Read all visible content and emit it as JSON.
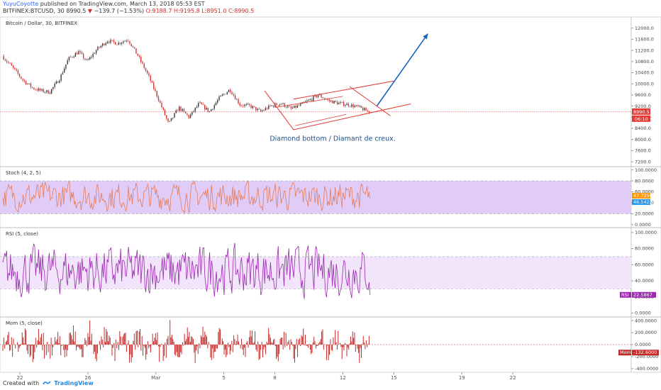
{
  "header": {
    "user": "YuyuCoyotte",
    "published": "published on TradingView.com, March 13, 2018 05:53 EST",
    "symbol": "BITFINEX:BTCUSD, 30",
    "last": "8990.5",
    "change": "−139.7 (−1.53%)",
    "ohlc": "O:9188.7 H:9195.8 L:8951.0 C:8990.5"
  },
  "footer": {
    "created": "Created with",
    "brand": "TradingView"
  },
  "colors": {
    "candle_up": "#333333",
    "candle_down": "#d32f2f",
    "pattern": "#e53935",
    "arrow": "#1565c0",
    "stoch_line": "#e57c5a",
    "stoch_band": "#e0ccf6",
    "rsi_line": "#9c27b0",
    "rsi_band": "#f1e4fb",
    "mom_line": "#c62828",
    "price_line": "#e53935"
  },
  "chart_data": [
    {
      "type": "candlestick",
      "title": "Bitcoin / Dollar, 30, BITFINEX",
      "y_ticks": [
        "12000.0",
        "11600.0",
        "11200.0",
        "10800.0",
        "10400.0",
        "10000.0",
        "9600.0",
        "9200.0",
        "8800.0",
        "8400.0",
        "8000.0",
        "7600.0",
        "7200.0"
      ],
      "ylim": [
        7050,
        12400
      ],
      "last_price": "8990.5",
      "countdown": "06:10",
      "close_path": {
        "x_days": [
          0.0,
          0.6,
          1.2,
          1.8,
          2.3,
          2.8,
          3.4,
          3.9,
          4.5,
          5.0,
          5.6,
          6.2,
          6.8,
          7.4,
          8.0,
          8.6,
          9.2,
          9.8,
          10.4,
          11.0,
          11.6,
          12.2,
          12.8,
          13.4,
          14.0,
          14.6,
          15.2,
          15.8,
          16.4,
          17.0,
          17.6,
          18.2,
          18.6,
          19.2,
          19.8,
          20.4,
          21.0,
          21.6
        ],
        "close": [
          11000,
          10600,
          10150,
          9850,
          9750,
          9700,
          10200,
          10900,
          11150,
          10800,
          11250,
          11550,
          11450,
          11600,
          11000,
          10300,
          9450,
          8550,
          9150,
          8800,
          9300,
          9000,
          9500,
          9800,
          9250,
          9200,
          9000,
          9200,
          9300,
          9100,
          9250,
          9450,
          9600,
          9400,
          9300,
          9250,
          9150,
          8990
        ]
      },
      "annotations": [
        "Diamond bottom / Diamant de creux."
      ]
    },
    {
      "type": "line",
      "title": "Stoch (4, 2, 5)",
      "y_ticks": [
        "100.0000",
        "80.0000",
        "60.0000",
        "40.0000",
        "20.0000",
        "0.0000"
      ],
      "ylim": [
        -4,
        106
      ],
      "band": [
        20,
        80
      ],
      "last_values": [
        "47.7259",
        "46.5422"
      ],
      "range": [
        18,
        86
      ]
    },
    {
      "type": "line",
      "title": "RSI (5, close)",
      "y_ticks": [
        "100.0000",
        "80.0000",
        "60.0000",
        "40.0000",
        "20.0000",
        "0.0000"
      ],
      "ylim": [
        -4,
        106
      ],
      "band": [
        30,
        70
      ],
      "last_value": "22.5867",
      "last_label": "RSI",
      "range": [
        12,
        92
      ]
    },
    {
      "type": "bar",
      "title": "Mom (5, close)",
      "y_ticks": [
        "400.0000",
        "200.0000",
        "0.0000",
        "-200.0000",
        "-400.0000"
      ],
      "ylim": [
        -460,
        460
      ],
      "last_value": "-132.6000",
      "last_label": "Mom",
      "range": [
        -420,
        420
      ]
    }
  ],
  "x_axis": {
    "labels": [
      "22",
      "26",
      "Mar",
      "5",
      "8",
      "12",
      "15",
      "19",
      "22"
    ],
    "label_days": [
      1,
      5,
      9,
      13,
      16,
      20,
      23,
      27,
      30
    ]
  }
}
